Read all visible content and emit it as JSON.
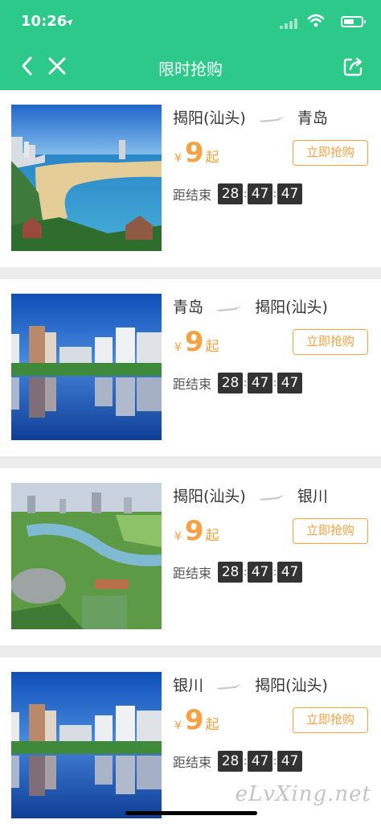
{
  "status_bar": {
    "time": "10:26"
  },
  "nav": {
    "title": "限时抢购"
  },
  "items": [
    {
      "from": "揭阳(汕头)",
      "to": "青岛",
      "currency": "¥",
      "price": "9",
      "suffix": "起",
      "button": "立即抢购",
      "countdown_label": "距结束",
      "h": "28",
      "m": "47",
      "s": "47",
      "image": "beach-city-photo"
    },
    {
      "from": "青岛",
      "to": "揭阳(汕头)",
      "currency": "¥",
      "price": "9",
      "suffix": "起",
      "button": "立即抢购",
      "countdown_label": "距结束",
      "h": "28",
      "m": "47",
      "s": "47",
      "image": "waterfront-skyline-photo"
    },
    {
      "from": "揭阳(汕头)",
      "to": "银川",
      "currency": "¥",
      "price": "9",
      "suffix": "起",
      "button": "立即抢购",
      "countdown_label": "距结束",
      "h": "28",
      "m": "47",
      "s": "47",
      "image": "park-river-aerial-photo"
    },
    {
      "from": "银川",
      "to": "揭阳(汕头)",
      "currency": "¥",
      "price": "9",
      "suffix": "起",
      "button": "立即抢购",
      "countdown_label": "距结束",
      "h": "28",
      "m": "47",
      "s": "47",
      "image": "waterfront-skyline-photo"
    }
  ],
  "watermark": "eLvXing.net",
  "colors": {
    "header": "#2cc98a",
    "accent": "#f7a142",
    "timer_bg": "#333333"
  }
}
